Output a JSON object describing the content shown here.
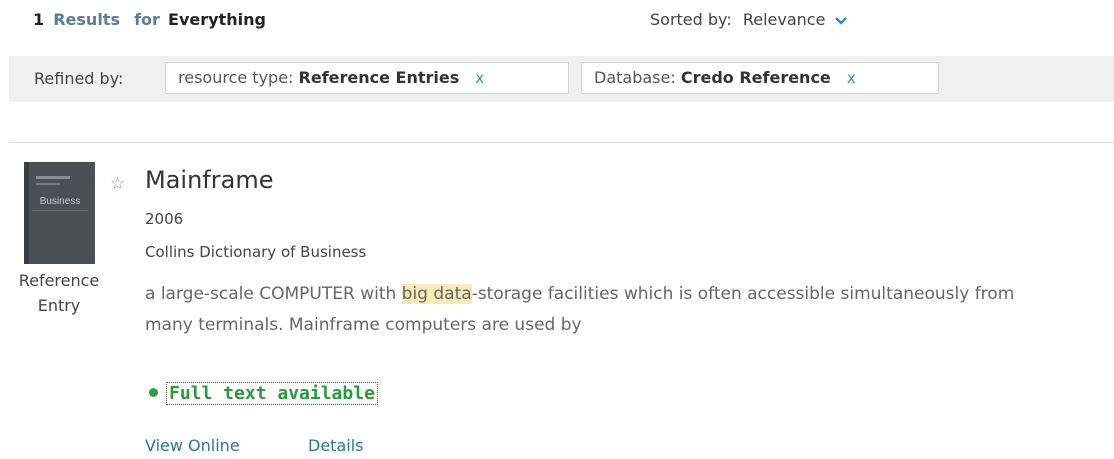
{
  "results_header": {
    "count": "1",
    "label": "Results",
    "for": "for",
    "scope": "Everything"
  },
  "sort": {
    "label": "Sorted by:",
    "value": "Relevance",
    "caret_icon": "chevron-down-icon"
  },
  "refine": {
    "label": "Refined by:",
    "chips": [
      {
        "facet": "resource type:",
        "value": "Reference Entries",
        "close": "x"
      },
      {
        "facet": "Database:",
        "value": "Credo Reference",
        "close": "x"
      }
    ]
  },
  "result": {
    "title": "Mainframe",
    "year": "2006",
    "source": "Collins Dictionary of Business",
    "type_line1": "Reference",
    "type_line2": "Entry",
    "thumbnail_text": "Business",
    "abstract_pre": "a large-scale COMPUTER with ",
    "abstract_hl1": "big",
    "abstract_hl2": "data",
    "abstract_post": "-storage facilities which is often accessible simultaneously from many terminals. Mainframe computers are used by",
    "full_text": "Full text available",
    "view_online": "View Online",
    "details": "Details"
  },
  "colors": {
    "accent_link": "#2a7a8c",
    "full_text_green": "#2a9a38",
    "highlight": "#f7ecb5",
    "close_x": "#2f8fd1"
  }
}
